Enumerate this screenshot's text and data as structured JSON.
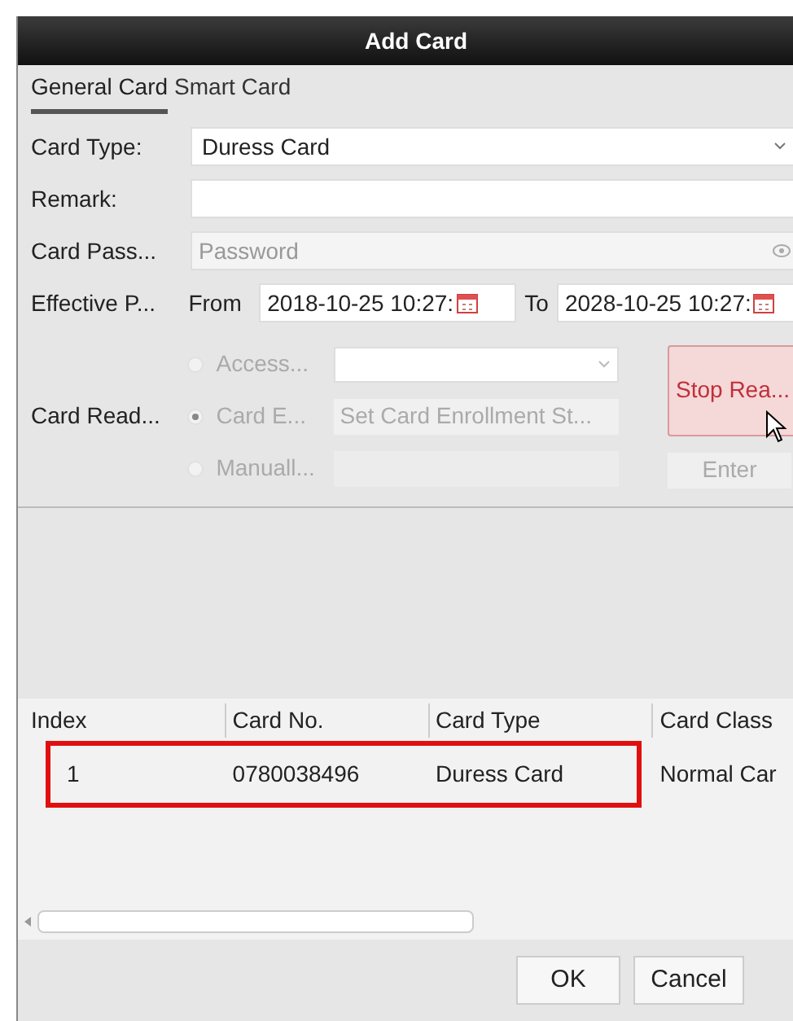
{
  "window": {
    "title": "Add Card"
  },
  "tabs": [
    {
      "label": "General Card",
      "selected": true
    },
    {
      "label": "Smart Card",
      "selected": false
    }
  ],
  "form": {
    "card_type": {
      "label": "Card Type:",
      "value": "Duress Card"
    },
    "remark": {
      "label": "Remark:"
    },
    "password": {
      "label": "Card Pass...",
      "placeholder": "Password"
    },
    "effective": {
      "label": "Effective P...",
      "from_label": "From",
      "from": "2018-10-25 10:27:",
      "to_label": "To",
      "to": "2028-10-25 10:27:"
    }
  },
  "card_reader": {
    "label": "Card Read...",
    "options": [
      {
        "kind": "dropdown",
        "label": "Access...",
        "selected": false
      },
      {
        "kind": "text",
        "label": "Card E...",
        "value": "Set Card Enrollment St...",
        "selected": true
      },
      {
        "kind": "input",
        "label": "Manuall...",
        "selected": false
      }
    ],
    "read_button": "Stop Rea...",
    "enter_button": "Enter"
  },
  "table": {
    "columns": [
      "Index",
      "Card No.",
      "Card Type",
      "Card Class"
    ],
    "rows": [
      {
        "cells": [
          "1",
          "0780038496",
          "Duress Card",
          "Normal Car"
        ],
        "annotated": true
      }
    ]
  },
  "buttons": [
    "OK",
    "Cancel"
  ]
}
